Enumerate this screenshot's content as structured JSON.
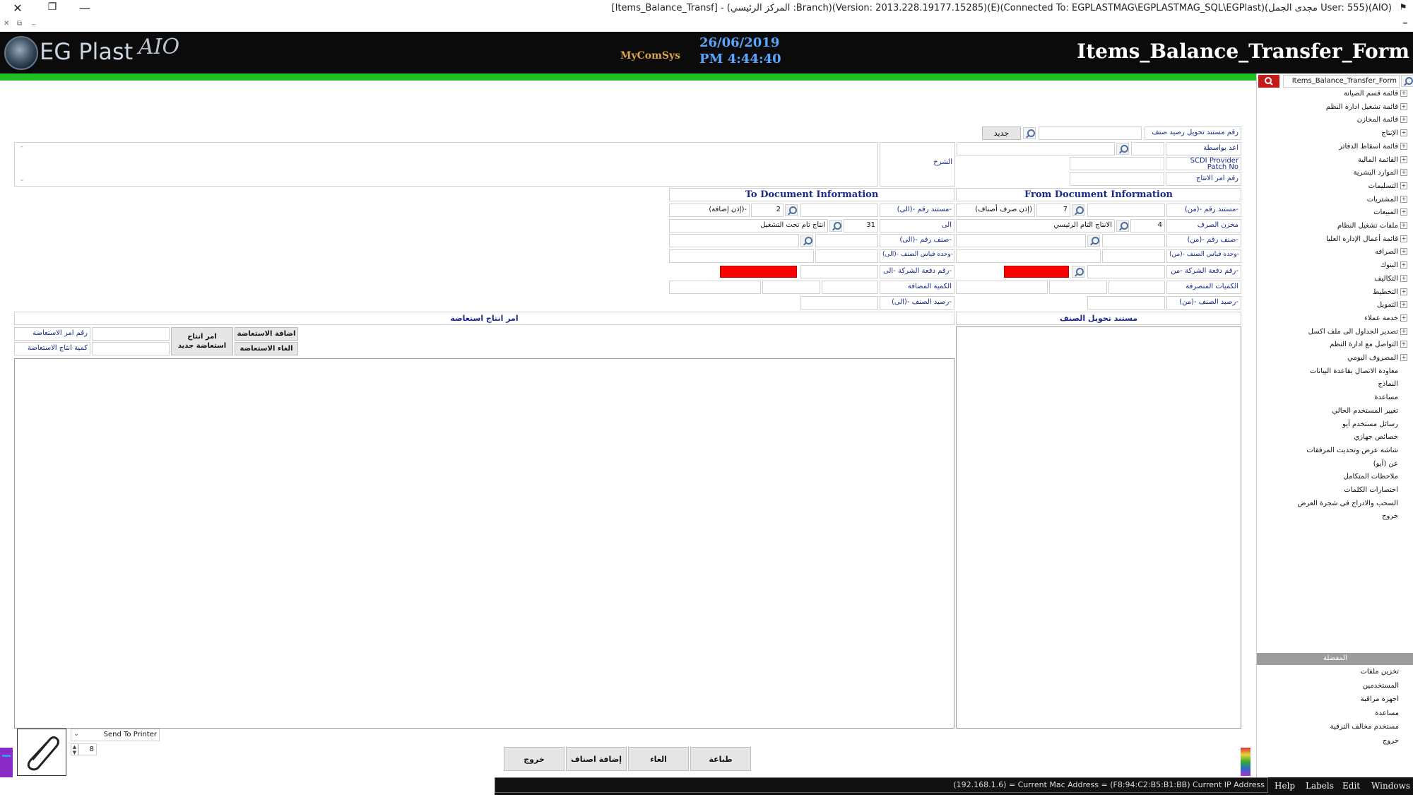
{
  "window": {
    "title": "[Items_Balance_Transf] - (المركز الرئيسي :Branch)(Version: 2013.228.19177.15285)(E)(Connected To: EGPLASTMAG\\EGPLASTMAG_SQL\\EGPlast)(مجدى الجمل User: 555)(AIO)",
    "close": "✕",
    "restore": "❐",
    "minimize": "—",
    "sub_close": "✕",
    "sub_restore": "⧉",
    "sub_min": "_",
    "flag": "⚑",
    "sub_right": "═"
  },
  "header": {
    "brand": "EG Plast",
    "brand_suffix": "AIO",
    "partner": "MyComSys",
    "date": "26/06/2019",
    "time": "PM 4:44:40",
    "form_name": "Items_Balance_Transfer_Form"
  },
  "top_form": {
    "doc_no_label": "رقم مستند تحويل رصيد صنف",
    "new_button": "جديد",
    "prepared_by_label": "اعد بواسطة",
    "notes_label": "الشرح",
    "scdi_label": "SCDI Provider",
    "patch_label": "Patch No",
    "prod_order_label": "رقم امر الانتاج"
  },
  "from_section": {
    "title": "From Document Information",
    "doc_no_label": "مستند رقم -(من)-",
    "doc_no_value": "7",
    "doc_type": "(إذن صرف أصناف)",
    "store_label": "مخزن الصرف",
    "store_code": "4",
    "store_name": "الانتاج التام الرئيسي",
    "item_label": "صنف رقم -(من)-",
    "unit_label": "وحده قياس الصنف -(من)-",
    "batch_label": "رقم دفعة الشركة -من-",
    "qty_label": "الكميات المنصرفة",
    "balance_label": "رصيد الصنف -(من)-"
  },
  "to_section": {
    "title": "To Document Information",
    "doc_no_label": "مستند رقم -(الى)-",
    "doc_no_value": "2",
    "doc_type": "(إذن إضافة)-",
    "store_label": "الى",
    "store_code": "31",
    "store_name": "انتاج تام تحت التشغيل",
    "item_label": "صنف رقم -(الى)-",
    "unit_label": "وحده قياس الصنف -(الى)-",
    "batch_label": "رقم دفعة الشركة -الى-",
    "qty_label": "الكمية المضافة",
    "balance_label": "رصيد الصنف -(الى)-"
  },
  "lower": {
    "item_doc_title": "مستند تحويل الصنف",
    "recovery_title": "امر انتاج استعاضة",
    "recovery_order_label": "رقم امر الاستعاضة",
    "recovery_qty_label": "كمية انتاج الاستعاضة",
    "new_recovery_btn": "امر انتاج استعاضة جديد",
    "add_recovery_btn": "اضافة الاستعاضة",
    "cancel_recovery_btn": "الغاء الاستعاضة"
  },
  "footer": {
    "exit": "خروج",
    "add_items": "إضافة اصناف",
    "cancel": "الغاء",
    "print": "طباعة",
    "printer_select": "Send To Printer",
    "copies": "8"
  },
  "sidebar": {
    "search_value": "Items_Balance_Transfer_Form",
    "tree": [
      {
        "label": "قائمة قسم الصيانة",
        "expandable": true
      },
      {
        "label": "قائمة تشغيل ادارة النظم",
        "expandable": true
      },
      {
        "label": "قائمة المخازن",
        "expandable": true
      },
      {
        "label": "الإنتاج",
        "expandable": true
      },
      {
        "label": "قائمة اسقاط الدفاتر",
        "expandable": true
      },
      {
        "label": "القائمة المالية",
        "expandable": true
      },
      {
        "label": "الموارد البشرية",
        "expandable": true
      },
      {
        "label": "التسليمات",
        "expandable": true
      },
      {
        "label": "المشتريات",
        "expandable": true
      },
      {
        "label": "المبيعات",
        "expandable": true
      },
      {
        "label": "ملفات تشغيل النظام",
        "expandable": true
      },
      {
        "label": "قائمة أعمال الإدارة العليا",
        "expandable": true
      },
      {
        "label": "الصرافه",
        "expandable": true
      },
      {
        "label": "البنوك",
        "expandable": true
      },
      {
        "label": "التكاليف",
        "expandable": true
      },
      {
        "label": "التخطيط",
        "expandable": true
      },
      {
        "label": "التمويل",
        "expandable": true
      },
      {
        "label": "خدمة عملاء",
        "expandable": true
      },
      {
        "label": "تصدير الجداول الى ملف اكسل",
        "expandable": true
      },
      {
        "label": "التواصل مع ادارة النظم",
        "expandable": true
      },
      {
        "label": "المصروف اليومي",
        "expandable": true
      },
      {
        "label": "معاودة الاتصال بقاعدة البيانات",
        "expandable": false
      },
      {
        "label": "النماذج",
        "expandable": false
      },
      {
        "label": "مساعدة",
        "expandable": false
      },
      {
        "label": "تغيير المستخدم الحالي",
        "expandable": false
      },
      {
        "label": "رسائل مستخدم آيو",
        "expandable": false
      },
      {
        "label": "خصائص جهازي",
        "expandable": false
      },
      {
        "label": "شاشة عرض وتحديث المرفقات",
        "expandable": false
      },
      {
        "label": "عن (آيو)",
        "expandable": false
      },
      {
        "label": "ملاحظات المتكامل",
        "expandable": false
      },
      {
        "label": "اختصارات الكلمات",
        "expandable": false
      },
      {
        "label": "السحب والادراج فى شجرة العرض",
        "expandable": false
      },
      {
        "label": "خروج",
        "expandable": false
      }
    ],
    "favorites_title": "المفضلة",
    "favorites": [
      "تخزين ملفات",
      "المستخدمين",
      "اجهزة مراقبة",
      "مساعدة",
      "مستخدم مخالف الترقية",
      "خروج"
    ]
  },
  "statusbar": {
    "ip_text": "(192.168.1.6) = Current Mac Address = (F8:94:C2:B5:B1:BB) Current IP Address",
    "menu": [
      "Help",
      "Labels",
      "Edit",
      "Windows"
    ]
  }
}
